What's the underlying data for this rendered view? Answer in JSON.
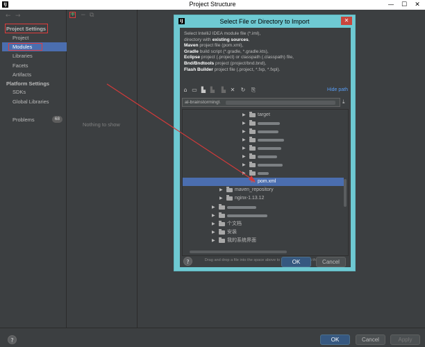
{
  "window": {
    "title": "Project Structure",
    "app_icon": "IJ",
    "minimize": "—",
    "maximize": "☐",
    "close": "✕"
  },
  "sidebar": {
    "back_icon": "←",
    "forward_icon": "→",
    "project_settings": "Project Settings",
    "items_project": [
      "Project",
      "Modules",
      "Libraries",
      "Facets",
      "Artifacts"
    ],
    "selected": "Modules",
    "platform_settings": "Platform Settings",
    "items_platform": [
      "SDKs",
      "Global Libraries"
    ],
    "problems": "Problems",
    "problems_count": "68"
  },
  "middle": {
    "add_icon": "+",
    "remove_icon": "−",
    "copy_icon": "⧉",
    "empty_text": "Nothing to show"
  },
  "dialog": {
    "title": "Select File or Directory to Import",
    "icon": "IJ",
    "close": "✕",
    "desc_lines": [
      {
        "pre": "Select IntelliJ IDEA module file (*.iml),",
        "bold": "",
        "post": ""
      },
      {
        "pre": "directory with ",
        "bold": "existing sources",
        "post": ","
      },
      {
        "pre": "",
        "bold": "Maven",
        "post": " project file (pom.xml),"
      },
      {
        "pre": "",
        "bold": "Gradle",
        "post": " build script (*.gradle, *.gradle.kts),"
      },
      {
        "pre": "",
        "bold": "Eclipse",
        "post": " project (.project) or classpath (.classpath) file,"
      },
      {
        "pre": "",
        "bold": "Bnd/Bndtools",
        "post": " project (project/bnd.bnd),"
      },
      {
        "pre": "",
        "bold": "Flash Builder",
        "post": " project file (.project, *.fxp, *.fxpl)."
      }
    ],
    "hide_path": "Hide path",
    "path_value": "al-brainstorming\\",
    "tree": {
      "target": "target",
      "pom": "pom.xml",
      "maven_repository": "maven_repository",
      "nginx": "nginx-1.13.12",
      "cn1": "个文档",
      "cn2": "安装",
      "cn3": "我的系统界面"
    },
    "drag_hint": "Drag and drop a file into the space above to quickly locate it in the tree",
    "help": "?",
    "ok": "OK",
    "cancel": "Cancel"
  },
  "footer": {
    "help": "?",
    "ok": "OK",
    "cancel": "Cancel",
    "apply": "Apply"
  },
  "colors": {
    "accent": "#4b6eaf",
    "highlight_red": "#e03c3c",
    "dialog_frame": "#6ec9d2",
    "background": "#3c3f41"
  }
}
